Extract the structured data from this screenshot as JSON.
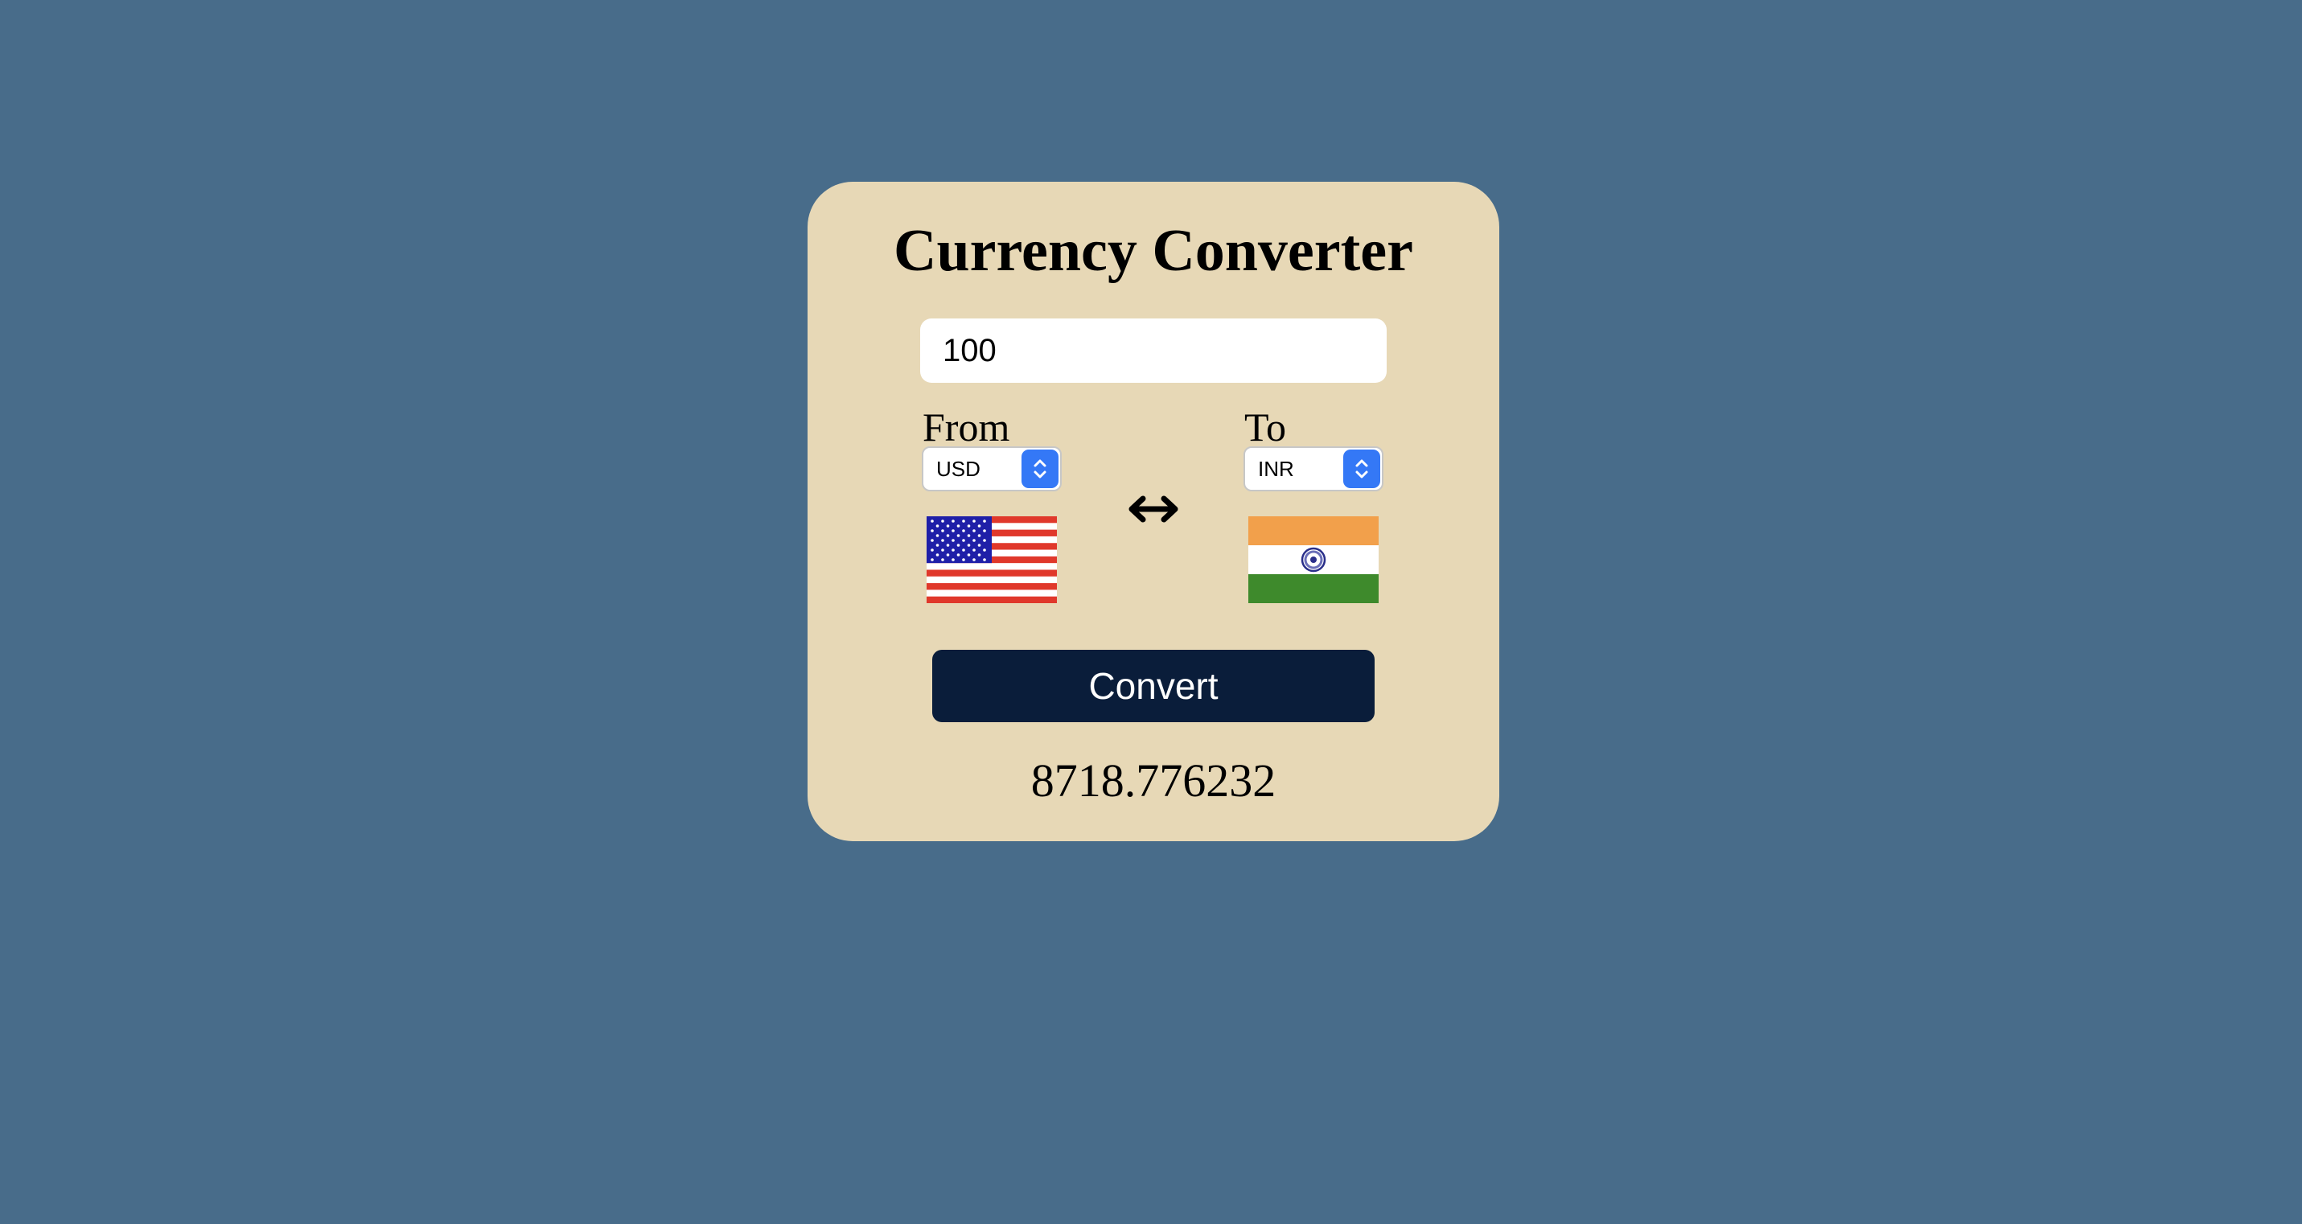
{
  "app": {
    "title": "Currency Converter"
  },
  "amount": {
    "value": "100"
  },
  "from": {
    "label": "From",
    "selected": "USD",
    "flag": "us-flag"
  },
  "to": {
    "label": "To",
    "selected": "INR",
    "flag": "india-flag"
  },
  "swap": {
    "icon": "left-right-arrow-icon"
  },
  "actions": {
    "convert_label": "Convert"
  },
  "result": {
    "value": "8718.776232"
  },
  "colors": {
    "page_background": "#486c8a",
    "card_background": "#e7d8b6",
    "button_background": "#0a1d3a",
    "select_accent": "#3478f6"
  }
}
